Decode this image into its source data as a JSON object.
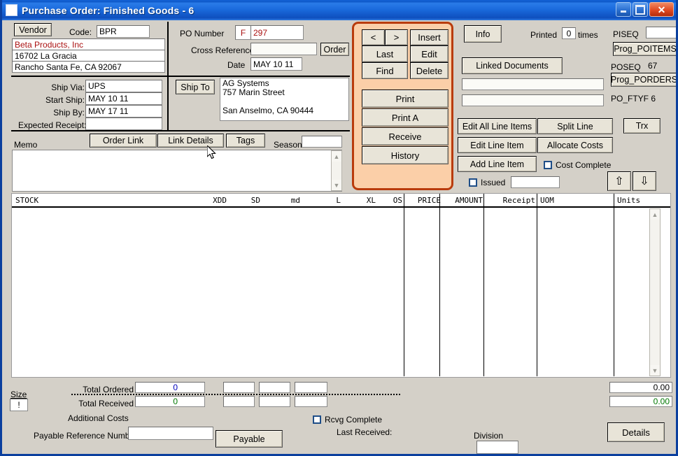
{
  "window": {
    "title": "Purchase Order: Finished Goods  -  6",
    "controls": {
      "minimize": "minimize-button",
      "maximize": "maximize-button",
      "close": "✕"
    }
  },
  "vendor": {
    "button_label": "Vendor",
    "code_label": "Code:",
    "code_value": "BPR",
    "name": "Beta Products, Inc",
    "address1": "16702 La Gracia",
    "address2": "Rancho Santa Fe, CA 92067",
    "name_color": "#aa1111"
  },
  "po": {
    "number_label": "PO Number",
    "prefix": "F",
    "number": "297",
    "cross_reference_label": "Cross Reference",
    "cross_reference_value": "",
    "order_button": "Order",
    "date_label": "Date",
    "date_value": "MAY 10 11"
  },
  "shipping": {
    "ship_via_label": "Ship Via:",
    "ship_via_value": "UPS",
    "start_ship_label": "Start Ship:",
    "start_ship_value": "MAY 10 11",
    "ship_by_label": "Ship By:",
    "ship_by_value": "MAY 17 11",
    "expected_receipt_label": "Expected Receipt:",
    "expected_receipt_value": "",
    "ship_to_button": "Ship To",
    "ship_to_line1": "AG Systems",
    "ship_to_line2": "757 Marin Street",
    "ship_to_line3": "",
    "ship_to_line4": "San Anselmo, CA 90444"
  },
  "memo": {
    "label": "Memo",
    "value": "",
    "order_link_button": "Order Link",
    "link_details_button": "Link Details",
    "tags_button": "Tags",
    "season_label": "Season",
    "season_value": ""
  },
  "actions": {
    "prev": "<",
    "next": ">",
    "insert": "Insert",
    "last": "Last",
    "edit": "Edit",
    "find": "Find",
    "delete": "Delete",
    "print": "Print",
    "print_a": "Print A",
    "receive": "Receive",
    "history": "History",
    "panel_color": "#fbcfa8",
    "panel_border_color": "#b93b0c"
  },
  "info": {
    "info_button": "Info",
    "printed_label": "Printed",
    "printed_count": "0",
    "times_label": "times",
    "linked_documents_button": "Linked Documents",
    "linked_field_1": "",
    "linked_field_2": ""
  },
  "prog": {
    "piseq_label": "PISEQ",
    "piseq_value": "",
    "prog_poitems_button": "Prog_POITEMS",
    "poseq_label": "POSEQ",
    "poseq_value": "67",
    "prog_porders_button": "Prog_PORDERS",
    "po_ftyf_label": "PO_FTYF 6"
  },
  "lineitems": {
    "edit_all_line_items": "Edit All Line Items",
    "split_line": "Split Line",
    "trx": "Trx",
    "edit_line_item": "Edit Line Item",
    "allocate_costs": "Allocate Costs",
    "add_line_item": "Add Line Item",
    "cost_complete_label": "Cost Complete",
    "cost_complete_checked": false,
    "issued_label": "Issued",
    "issued_checked": false,
    "issued_value": "",
    "move_up_icon": "⇧",
    "move_down_icon": "⇩"
  },
  "grid": {
    "columns": [
      {
        "label": "STOCK",
        "align": "left"
      },
      {
        "label": "XDD",
        "align": "right"
      },
      {
        "label": "SD",
        "align": "right"
      },
      {
        "label": "md",
        "align": "right"
      },
      {
        "label": "L",
        "align": "right"
      },
      {
        "label": "XL",
        "align": "right"
      },
      {
        "label": "OS",
        "align": "right"
      },
      {
        "label": "PRICE",
        "align": "right"
      },
      {
        "label": "AMOUNT",
        "align": "right"
      },
      {
        "label": "Receipt",
        "align": "right"
      },
      {
        "label": "UOM",
        "align": "left"
      },
      {
        "label": "Units",
        "align": "left"
      }
    ],
    "rows": []
  },
  "totals": {
    "size_label": "Size",
    "size_value": "!",
    "total_ordered_label": "Total Ordered",
    "total_ordered_value": "0",
    "total_ordered_color": "#0000bb",
    "total_received_label": "Total Received",
    "total_received_value": "0",
    "total_received_color": "#007700",
    "amount_ordered_value": "0.00",
    "amount_received_value": "0.00",
    "additional_costs_label": "Additional Costs",
    "payable_reference_label": "Payable Reference Number",
    "payable_reference_value": "",
    "payable_button": "Payable",
    "rcvg_complete_label": "Rcvg Complete",
    "rcvg_complete_checked": false,
    "last_received_label": "Last Received:",
    "division_label": "Division",
    "division_value": "",
    "details_button": "Details"
  }
}
